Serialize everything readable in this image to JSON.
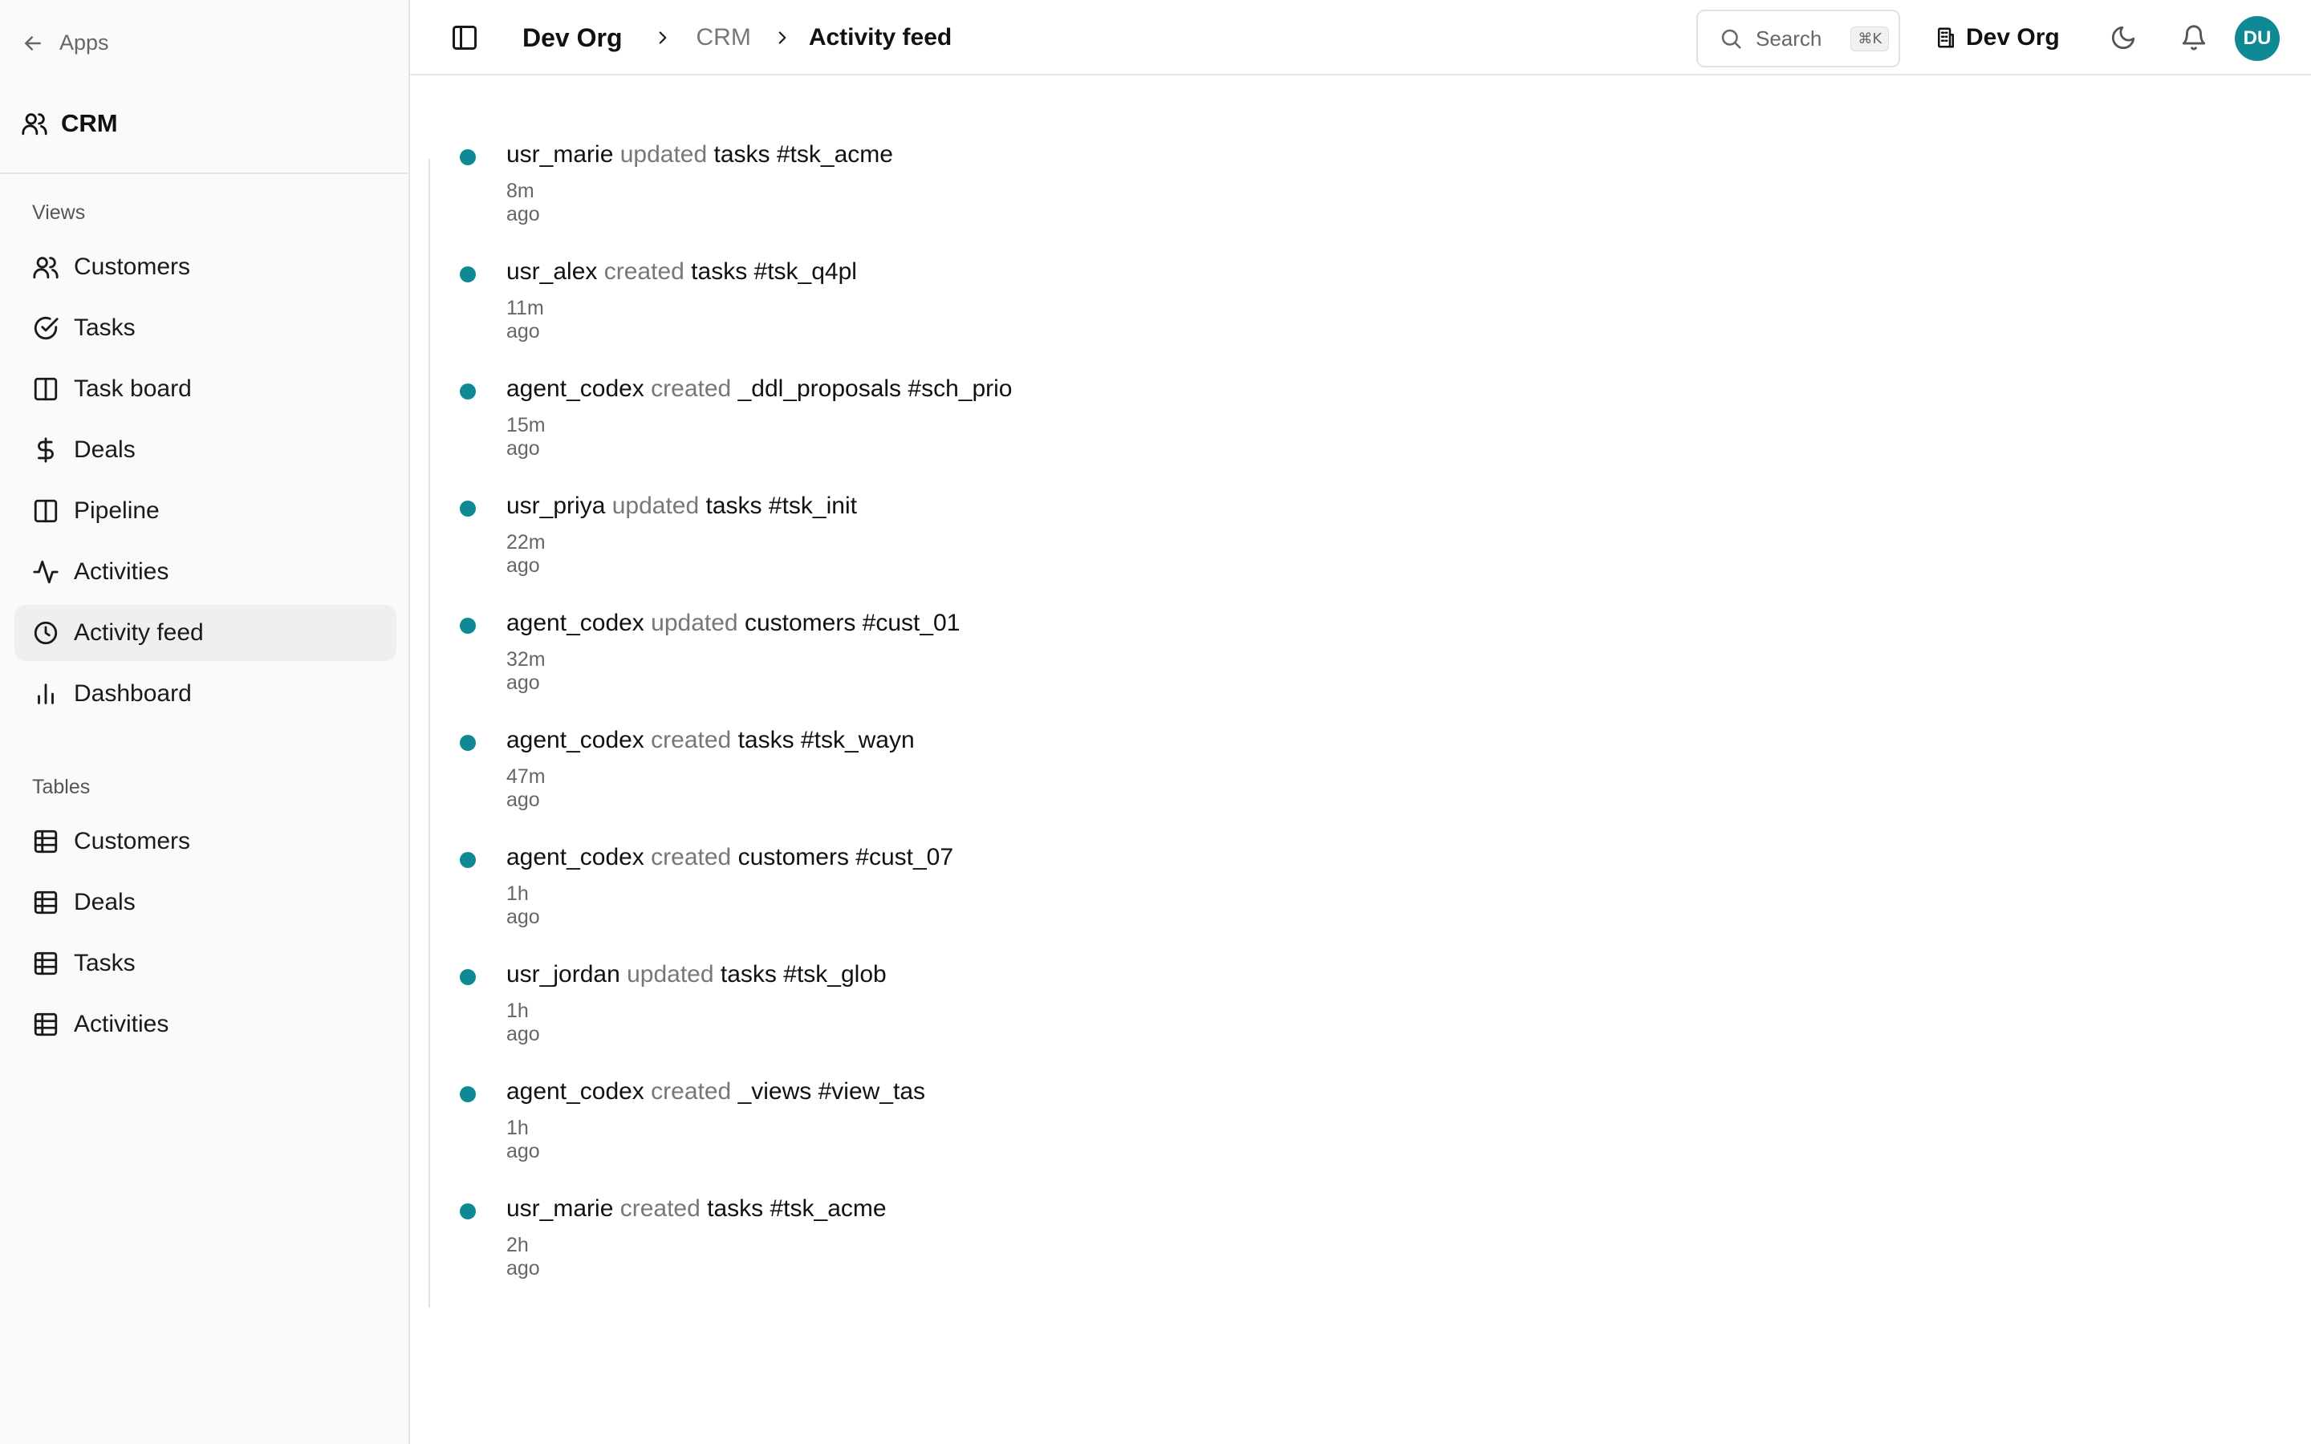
{
  "sidebar": {
    "apps_label": "Apps",
    "app_title": "CRM",
    "views_label": "Views",
    "views": [
      {
        "label": "Customers",
        "icon": "users-icon"
      },
      {
        "label": "Tasks",
        "icon": "check-circle-icon"
      },
      {
        "label": "Task board",
        "icon": "columns-icon"
      },
      {
        "label": "Deals",
        "icon": "dollar-icon"
      },
      {
        "label": "Pipeline",
        "icon": "columns-icon"
      },
      {
        "label": "Activities",
        "icon": "activity-icon"
      },
      {
        "label": "Activity feed",
        "icon": "clock-icon",
        "active": true
      },
      {
        "label": "Dashboard",
        "icon": "bar-chart-icon"
      }
    ],
    "tables_label": "Tables",
    "tables": [
      {
        "label": "Customers",
        "icon": "table-icon"
      },
      {
        "label": "Deals",
        "icon": "table-icon"
      },
      {
        "label": "Tasks",
        "icon": "table-icon"
      },
      {
        "label": "Activities",
        "icon": "table-icon"
      }
    ]
  },
  "header": {
    "breadcrumb": [
      "Dev Org",
      "CRM",
      "Activity feed"
    ],
    "search_placeholder": "Search",
    "search_shortcut": "⌘K",
    "org_name": "Dev Org",
    "avatar_initials": "DU"
  },
  "colors": {
    "accent": "#0f8a94"
  },
  "feed": [
    {
      "actor": "usr_marie",
      "verb": "updated",
      "target": "tasks #tsk_acme",
      "time": "8m ago"
    },
    {
      "actor": "usr_alex",
      "verb": "created",
      "target": "tasks #tsk_q4pl",
      "time": "11m ago"
    },
    {
      "actor": "agent_codex",
      "verb": "created",
      "target": "_ddl_proposals #sch_prio",
      "time": "15m ago"
    },
    {
      "actor": "usr_priya",
      "verb": "updated",
      "target": "tasks #tsk_init",
      "time": "22m ago"
    },
    {
      "actor": "agent_codex",
      "verb": "updated",
      "target": "customers #cust_01",
      "time": "32m ago"
    },
    {
      "actor": "agent_codex",
      "verb": "created",
      "target": "tasks #tsk_wayn",
      "time": "47m ago"
    },
    {
      "actor": "agent_codex",
      "verb": "created",
      "target": "customers #cust_07",
      "time": "1h ago"
    },
    {
      "actor": "usr_jordan",
      "verb": "updated",
      "target": "tasks #tsk_glob",
      "time": "1h ago"
    },
    {
      "actor": "agent_codex",
      "verb": "created",
      "target": "_views #view_tas",
      "time": "1h ago"
    },
    {
      "actor": "usr_marie",
      "verb": "created",
      "target": "tasks #tsk_acme",
      "time": "2h ago"
    }
  ]
}
